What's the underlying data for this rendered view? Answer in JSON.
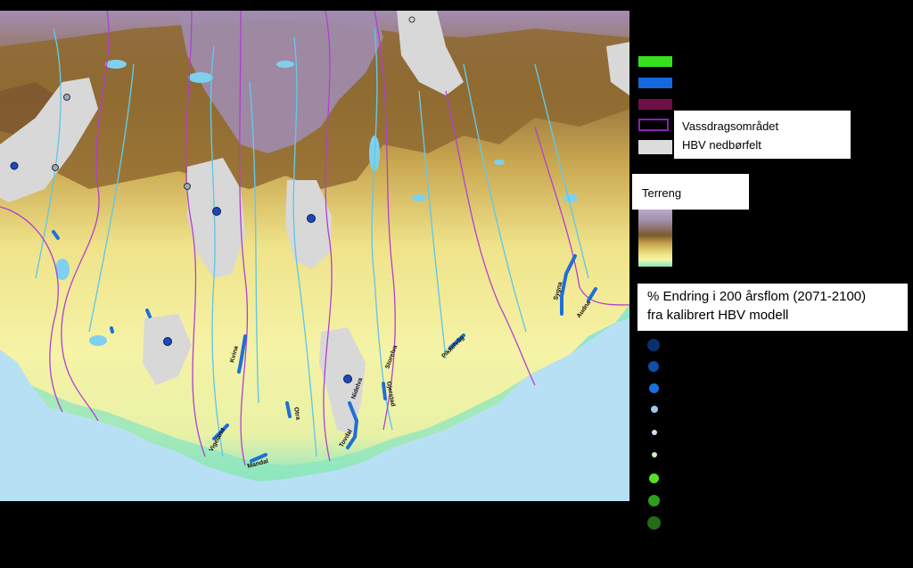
{
  "legend": {
    "line_colors": [
      "#37e01f",
      "#1469e0",
      "#6e0f45"
    ],
    "boundary": {
      "label": "Vassdragsområdet",
      "color": "#8a1fb5"
    },
    "catchment": {
      "label": "HBV nedbørfelt",
      "color": "#dcdcdc"
    },
    "terrain": {
      "title": "Terreng",
      "colors": [
        "#b9a9c9",
        "#a08da8",
        "#7a5a2a",
        "#c9a54f",
        "#ede484",
        "#f6f4a6",
        "#7fe7c4"
      ]
    },
    "change_title_line1": "% Endring i 200 årsflom (2071-2100)",
    "change_title_line2": "fra kalibrert HBV modell",
    "change_dot_colors": [
      "#0a2f6e",
      "#0f4ea8",
      "#1a6fdd",
      "#9fc6f2",
      "#cfe0f5",
      "#cff0b8",
      "#55e02a",
      "#2f9f1f",
      "#236b17"
    ]
  },
  "map": {
    "river_labels": [
      "Kvina",
      "Vigeland",
      "Mandal",
      "Otra",
      "Tovdal",
      "Nidelva",
      "Pikkelvåg",
      "Gjerstad",
      "Storelva",
      "Sygna",
      "Audna"
    ],
    "colors": {
      "sea": "#b8e0f5",
      "coast_green": "#7de3b9",
      "lowland": "#f3f0a0",
      "midland": "#dcc56a",
      "highland": "#8c6a2f",
      "mountain": "#9c86a6",
      "lake": "#7fd0ee",
      "river": "#65c7e6",
      "boundary": "#b23fd0",
      "catchment": "#d8d8d8",
      "station": "#1f47b8",
      "station_gray": "#9aa9b8",
      "highlight_river": "#1f6fd6"
    }
  }
}
